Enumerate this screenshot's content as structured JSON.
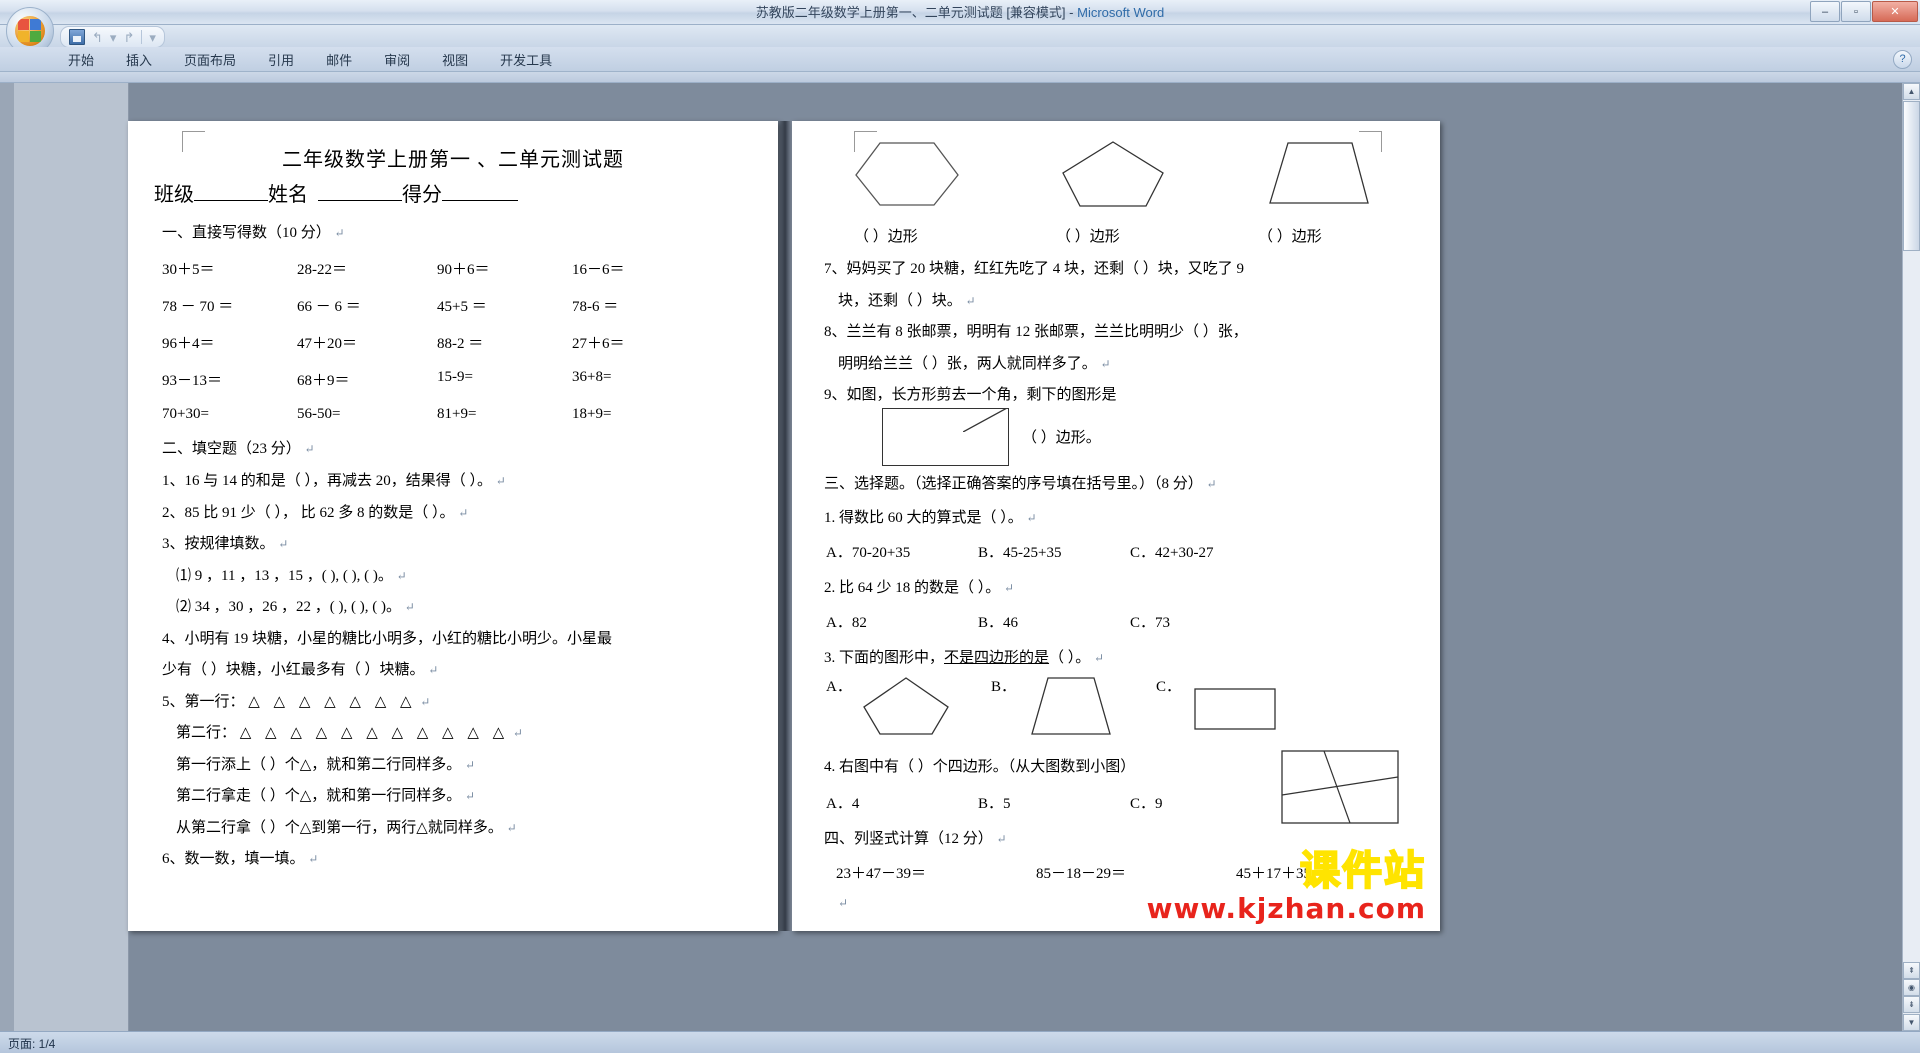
{
  "window": {
    "title": "苏教版二年级数学上册第一、二单元测试题 [兼容模式]",
    "separator": " - ",
    "app_name": "Microsoft Word",
    "minimize": "–",
    "maximize": "▫",
    "close": "✕",
    "help": "?"
  },
  "quick_access": {
    "save": "save-icon",
    "undo": "↰",
    "undo_caret": "▾",
    "redo": "↱",
    "customize": "▾"
  },
  "ribbon": {
    "tabs": [
      {
        "label": "开始"
      },
      {
        "label": "插入"
      },
      {
        "label": "页面布局"
      },
      {
        "label": "引用"
      },
      {
        "label": "邮件"
      },
      {
        "label": "审阅"
      },
      {
        "label": "视图"
      },
      {
        "label": "开发工具"
      }
    ]
  },
  "scrollbar": {
    "up": "▲",
    "down": "▼",
    "prev_page": "⇞",
    "next_page": "⇟",
    "select_object": "◉"
  },
  "status": {
    "page_info": "页面: 1/4"
  },
  "document": {
    "title": "二年级数学上册第一 、二单元测试题",
    "subheader": {
      "class_label": "班级",
      "name_label": "姓名",
      "score_label": "得分"
    },
    "section1": {
      "heading": "一、直接写得数（10 分）",
      "rows": [
        [
          "30＋5＝",
          "28-22＝",
          "90＋6＝",
          "16－6＝"
        ],
        [
          "78 － 70 ＝",
          "66 － 6 ＝",
          "45+5 ＝",
          "78-6 ＝"
        ],
        [
          "96＋4＝",
          "47＋20＝",
          "88-2 ＝",
          "27＋6＝"
        ],
        [
          "93－13＝",
          "68＋9＝",
          "15-9=",
          "36+8="
        ],
        [
          "70+30=",
          "56-50=",
          "81+9=",
          "18+9="
        ]
      ]
    },
    "section2": {
      "heading": "二、填空题（23 分）",
      "q1": "1、16 与 14 的和是（    ），再减去 20，结果得（    ）。",
      "q2": "2、85 比 91 少（    ）， 比 62 多 8 的数是（    ）。",
      "q3": "3、按规律填数。",
      "q3a": "⑴  9 ，11 ，13 ，15 ，(         ), (         ), (         )。",
      "q3b": "⑵ 34 ，30 ，26 ，22 ，(         ), (         ), (         )。",
      "q4a": "4、小明有 19 块糖，小星的糖比小明多，小红的糖比小明少。小星最",
      "q4b": "少有（      ）块糖，小红最多有（        ）块糖。",
      "q5_row1_label": "5、第一行：",
      "q5_row1_shapes": "△ △ △ △ △ △ △",
      "q5_row2_label": "第二行：",
      "q5_row2_shapes": "△ △ △ △ △ △ △ △ △ △ △",
      "q5a": "第一行添上（      ）个△，就和第二行同样多。",
      "q5b": "第二行拿走（      ）个△，就和第一行同样多。",
      "q5c": "从第二行拿（      ）个△到第一行，两行△就同样多。",
      "q6": "6、数一数，填一填。"
    },
    "right_page": {
      "shape_labels": [
        "（      ）边形",
        "（      ）边形",
        "（      ）边形"
      ],
      "q7a": "7、妈妈买了 20 块糖，红红先吃了 4 块，还剩（      ）块，又吃了 9",
      "q7b": "块，还剩（      ）块。",
      "q8a": "8、兰兰有 8 张邮票，明明有 12 张邮票，兰兰比明明少（      ）张，",
      "q8b": "明明给兰兰（      ）张，两人就同样多了。",
      "q9": "9、如图，长方形剪去一个角，剩下的图形是",
      "q9_label": "（      ）边形。",
      "section3_heading": "三、选择题。（选择正确答案的序号填在括号里。）（8 分）",
      "mc1": "1. 得数比 60 大的算式是（      ）。",
      "mc1_opts": [
        "A．70-20+35",
        "B．45-25+35",
        "C．42+30-27"
      ],
      "mc2": "2. 比 64 少 18 的数是（      ）。",
      "mc2_opts": [
        "A．82",
        "B．46",
        "C．73"
      ],
      "mc3_pre": "3. 下面的图形中，",
      "mc3_underline": "不是四边形的是",
      "mc3_post": "（      ）。",
      "mc3_opts": [
        "A．",
        "B．",
        "C．"
      ],
      "mc4": "4. 右图中有（      ）个四边形。（从大图数到小图）",
      "mc4_opts": [
        "A．4",
        "B．5",
        "C．9"
      ],
      "section4_heading": "四、列竖式计算（12 分）",
      "calc_row": [
        "23＋47－39＝",
        "85－18－29＝",
        "45＋17＋35＝"
      ]
    }
  },
  "watermark": {
    "line1": "课件站",
    "line2": "www.kjzhan.com"
  }
}
